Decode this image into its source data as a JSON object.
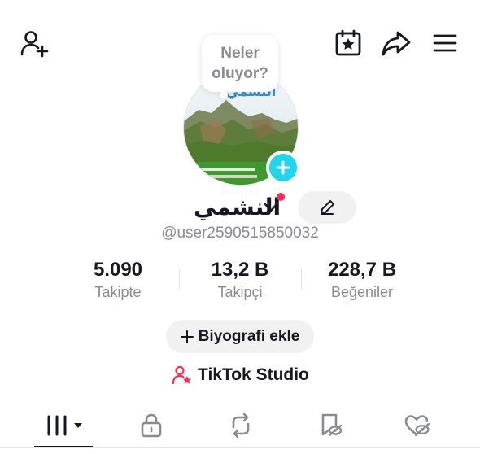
{
  "header": {
    "icons": [
      "add-friend-icon",
      "calendar-star-icon",
      "share-icon",
      "menu-icon"
    ]
  },
  "story_bubble": {
    "line1": "Neler",
    "line2": "oluyor?"
  },
  "profile": {
    "display_name": "النشمي",
    "username": "@user2590515850032",
    "avatar_overlay_text": "النشمي"
  },
  "stats": [
    {
      "value": "5.090",
      "label": "Takipte"
    },
    {
      "value": "13,2 B",
      "label": "Takipçi"
    },
    {
      "value": "228,7 B",
      "label": "Beğeniler"
    }
  ],
  "actions": {
    "bio_button_label": "Biyografi ekle",
    "studio_label": "TikTok Studio"
  },
  "tabs": [
    {
      "icon": "grid-icon",
      "active": true
    },
    {
      "icon": "lock-icon",
      "active": false
    },
    {
      "icon": "repost-icon",
      "active": false
    },
    {
      "icon": "saved-icon",
      "active": false
    },
    {
      "icon": "liked-hidden-icon",
      "active": false
    }
  ],
  "colors": {
    "accent_red": "#fe2c55",
    "accent_cyan": "#20d5ec",
    "text_primary": "#161823",
    "text_secondary": "#8a8b91"
  }
}
